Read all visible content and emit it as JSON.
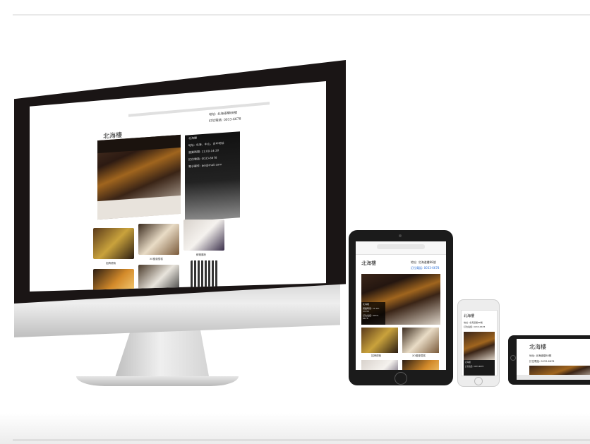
{
  "site": {
    "name": "北海樓",
    "address_label": "地址: 北海道樓88號",
    "phone_label": "訂位電話: 0033-6678"
  },
  "info_panel": {
    "title": "北海樓",
    "lines": [
      "地址: 北海、中山、台中地址",
      "營業時間: 11:00-14:30",
      "訂位電話: 0033-6678",
      "電子郵件: bei@mail.com"
    ]
  },
  "gallery": {
    "captions": [
      "招牌燒鴨",
      "XO醬蘿蔔糕",
      "鮮蝦腸粉"
    ]
  },
  "colors": {
    "bezel": "#1a1515",
    "link": "#2b6fd6",
    "panel": "#111111"
  },
  "icons": [
    "qr-code-icon",
    "home-button-icon",
    "camera-icon"
  ]
}
